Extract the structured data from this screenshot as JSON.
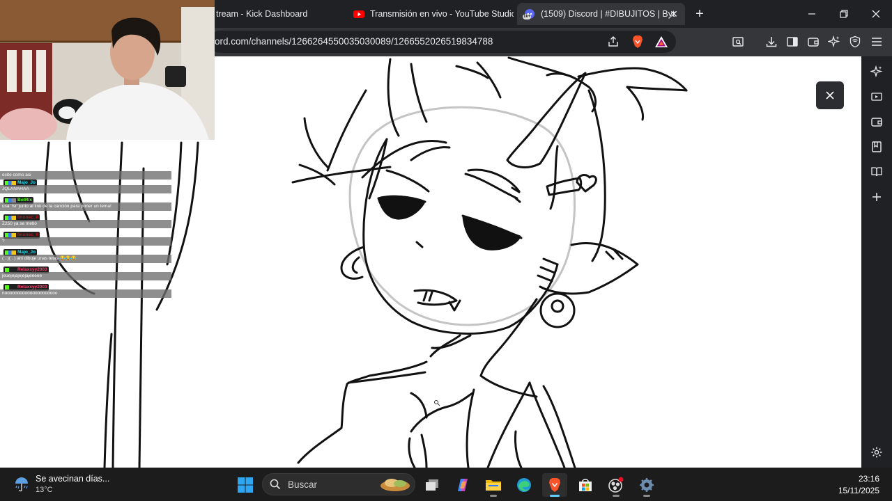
{
  "browser": {
    "tabs": [
      {
        "title": "tream - Kick Dashboard",
        "favicon": "kick-favicon"
      },
      {
        "title": "Transmisión en vivo - YouTube Studio",
        "favicon": "youtube-favicon"
      },
      {
        "title": "(1509) Discord | #DIBUJITOS | Byt",
        "favicon": "discord-favicon",
        "badge": "1k+",
        "active": true
      }
    ],
    "new_tab_icon": "plus-icon",
    "url": "ord.com/channels/1266264550035030089/1266552026519834788",
    "toolbar_icons": [
      "share-icon",
      "brave-shield-icon",
      "rewards-icon",
      "screenshot-icon",
      "download-icon",
      "sidebar-icon",
      "wallet-icon",
      "leo-ai-icon",
      "vpn-icon",
      "menu-icon"
    ],
    "side_panel_icons": [
      "leo-ai-icon",
      "media-icon",
      "wallet-icon",
      "bookmarks-icon",
      "reading-list-icon",
      "add-icon",
      "settings-icon"
    ]
  },
  "viewer": {
    "close_icon": "close-icon",
    "image_subject": "sketch-drawing"
  },
  "chat": {
    "messages": [
      {
        "text": "ecite como asi"
      },
      {
        "user": "Majo_Jo",
        "user_color": "#00e7ff",
        "text": "JQLANAHAA"
      },
      {
        "user": "BotRix",
        "user_color": "#53fc18",
        "text": "usa '!sr' junto al link de la canción para poner un tema!"
      },
      {
        "user": "Imonec_II",
        "user_color": "#d10e0e",
        "text": "Z250 ya se metió"
      },
      {
        "user": "Imonec_II",
        "user_color": "#d10e0e",
        "text": "?"
      },
      {
        "user": "Majo_Jo",
        "user_color": "#00e7ff",
        "text": "( . )( . ) ahi dibuje unas tetas 😂😂😂"
      },
      {
        "user": "Relaxxyy2003",
        "user_color": "#ff3d6e",
        "text": "jeuejejajejejajeeeee"
      },
      {
        "user": "Relaxxyy2003",
        "user_color": "#ff3d6e",
        "text": "nooooooooooooooooooooo"
      }
    ]
  },
  "taskbar": {
    "weather": {
      "text": "Se avecinan días...",
      "temp": "13°C",
      "icon": "rain-icon"
    },
    "search_placeholder": "Buscar",
    "apps": [
      "windows-start-icon",
      "task-view-icon",
      "copilot-icon",
      "file-explorer-icon",
      "edge-icon",
      "brave-icon",
      "store-icon",
      "obs-icon",
      "settings-icon"
    ],
    "active_app": "brave-icon",
    "time": "23:16",
    "date": "15/11/2025"
  }
}
